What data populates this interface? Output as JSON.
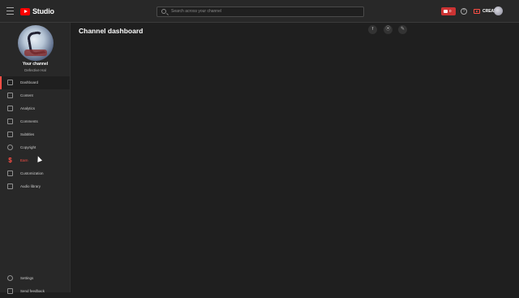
{
  "app": {
    "logo_text": "Studio"
  },
  "search": {
    "placeholder": "Search across your channel"
  },
  "topbar": {
    "live_count": "0",
    "help_symbol": "?",
    "create_label": "CREATE"
  },
  "channel": {
    "title": "Your channel",
    "name": "Defective Hal"
  },
  "nav": {
    "items": [
      {
        "label": "Dashboard",
        "icon": "dashboard-icon"
      },
      {
        "label": "Content",
        "icon": "content-icon"
      },
      {
        "label": "Analytics",
        "icon": "analytics-icon"
      },
      {
        "label": "Comments",
        "icon": "comments-icon"
      },
      {
        "label": "Subtitles",
        "icon": "subtitles-icon"
      },
      {
        "label": "Copyright",
        "icon": "copyright-icon"
      },
      {
        "label": "Earn",
        "icon": "dollar-icon"
      },
      {
        "label": "Customization",
        "icon": "customization-icon"
      },
      {
        "label": "Audio library",
        "icon": "audio-library-icon"
      }
    ],
    "bottom": [
      {
        "label": "Settings",
        "icon": "gear-icon"
      },
      {
        "label": "Send feedback",
        "icon": "feedback-icon"
      }
    ]
  },
  "main": {
    "title": "Channel dashboard",
    "header_icons": {
      "upload": "⭱",
      "live": "⦿",
      "create_post": "✎"
    }
  },
  "colors": {
    "accent": "#ff4e45",
    "brand_red": "#ff0000",
    "bg": "#1f1f1f",
    "panel": "#282828"
  }
}
